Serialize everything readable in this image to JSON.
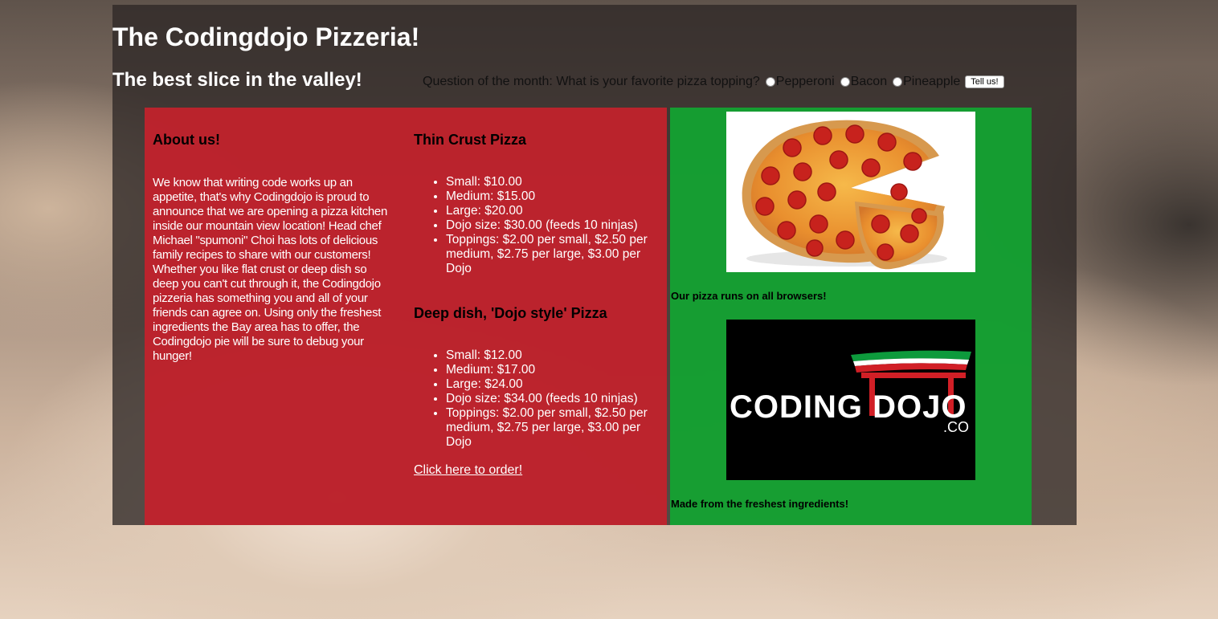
{
  "header": {
    "title": "The Codingdojo Pizzeria!",
    "tagline": "The best slice in the valley!"
  },
  "poll": {
    "question": "Question of the month: What is your favorite pizza topping?",
    "options": [
      "Pepperoni",
      "Bacon",
      "Pineapple"
    ],
    "submit_label": "Tell us!"
  },
  "about": {
    "heading": "About us!",
    "text": "We know that writing code works up an appetite, that's why Codingdojo is proud to announce that we are opening a pizza kitchen inside our mountain view location! Head chef Michael \"spumoni\" Choi has lots of delicious family recipes to share with our customers! Whether you like flat crust or deep dish so deep you can't cut through it, the Codingdojo pizzeria has something you and all of your friends can agree on. Using only the freshest ingredients the Bay area has to offer, the Codingdojo pie will be sure to debug your hunger!"
  },
  "menu": {
    "thin": {
      "heading": "Thin Crust Pizza",
      "items": [
        "Small: $10.00",
        "Medium: $15.00",
        "Large: $20.00",
        "Dojo size: $30.00 (feeds 10 ninjas)",
        "Toppings: $2.00 per small, $2.50 per medium, $2.75 per large, $3.00 per Dojo"
      ]
    },
    "deep": {
      "heading": "Deep dish, 'Dojo style' Pizza",
      "items": [
        "Small: $12.00",
        "Medium: $17.00",
        "Large: $24.00",
        "Dojo size: $34.00 (feeds 10 ninjas)",
        "Toppings: $2.00 per small, $2.50 per medium, $2.75 per large, $3.00 per Dojo"
      ]
    },
    "order_link": "Click here to order!"
  },
  "gallery": {
    "caption1": "Our pizza runs on all browsers!",
    "logo_text": "CODING DOJO",
    "logo_suffix": ".CO",
    "caption2": "Made from the freshest ingredients!"
  },
  "colors": {
    "red_panel": "#c4212c",
    "green_panel": "#12a532",
    "wrapper": "#2e2826"
  }
}
